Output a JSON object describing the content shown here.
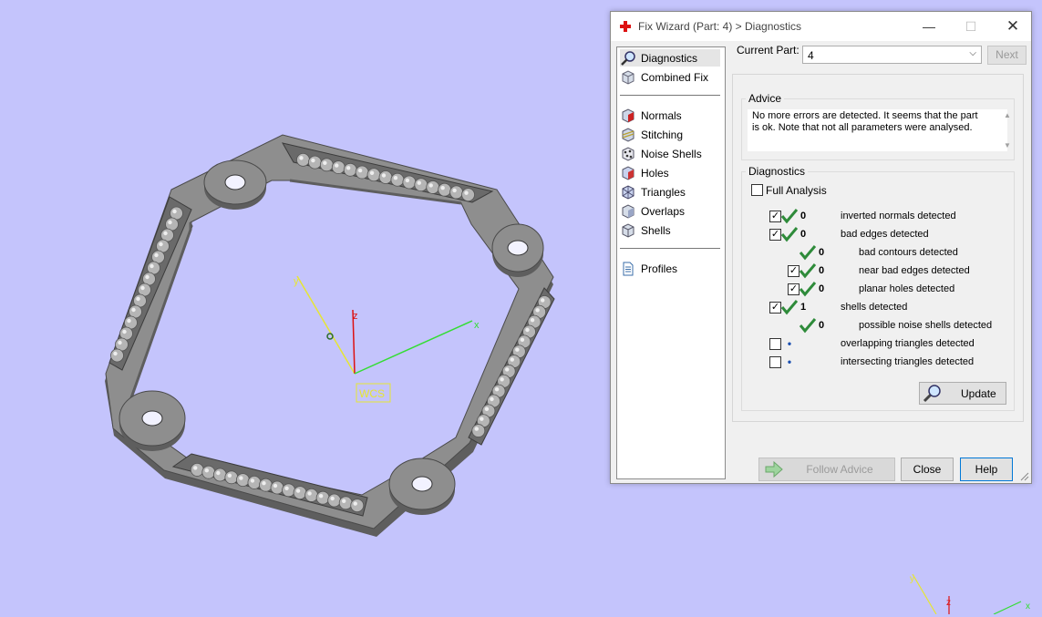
{
  "viewport": {
    "wcs_label": "WCS",
    "axis_x": "x",
    "axis_y": "y",
    "axis_z": "z",
    "colors": {
      "background": "#c4c4fc",
      "part": "#8e8e8e",
      "x_axis": "#33dd33",
      "y_axis": "#e6e633",
      "z_axis": "#dd1111"
    }
  },
  "window": {
    "title": "Fix Wizard (Part: 4) > Diagnostics",
    "controls": {
      "minimize": "—",
      "maximize": "☐",
      "close": "✕"
    }
  },
  "nav": {
    "top_items": [
      {
        "label": "Diagnostics",
        "icon": "magnifier-icon",
        "active": true
      },
      {
        "label": "Combined Fix",
        "icon": "cube-icon"
      }
    ],
    "fix_items": [
      {
        "label": "Normals",
        "icon": "normals-icon"
      },
      {
        "label": "Stitching",
        "icon": "stitching-icon"
      },
      {
        "label": "Noise Shells",
        "icon": "noise-shells-icon"
      },
      {
        "label": "Holes",
        "icon": "holes-icon"
      },
      {
        "label": "Triangles",
        "icon": "triangles-icon"
      },
      {
        "label": "Overlaps",
        "icon": "overlaps-icon"
      },
      {
        "label": "Shells",
        "icon": "shells-icon"
      }
    ],
    "bottom_items": [
      {
        "label": "Profiles",
        "icon": "document-icon"
      }
    ]
  },
  "part": {
    "label": "Current Part:",
    "value": "4",
    "next_label": "Next"
  },
  "advice": {
    "title": "Advice",
    "text": "No more errors are detected. It seems that the part is ok. Note that not all parameters were analysed."
  },
  "diagnostics": {
    "title": "Diagnostics",
    "full_analysis_label": "Full Analysis",
    "full_analysis_checked": false,
    "rows": [
      {
        "checkbox": true,
        "status": "ok",
        "count": "0",
        "label": "inverted normals detected",
        "indent": 0
      },
      {
        "checkbox": true,
        "status": "ok",
        "count": "0",
        "label": "bad edges detected",
        "indent": 0
      },
      {
        "checkbox": null,
        "status": "ok",
        "count": "0",
        "label": "bad contours detected",
        "indent": 1
      },
      {
        "checkbox": true,
        "status": "ok",
        "count": "0",
        "label": "near bad edges detected",
        "indent": 1
      },
      {
        "checkbox": true,
        "status": "ok",
        "count": "0",
        "label": "planar holes detected",
        "indent": 1
      },
      {
        "checkbox": true,
        "status": "ok",
        "count": "1",
        "label": "shells detected",
        "indent": 0
      },
      {
        "checkbox": null,
        "status": "ok",
        "count": "0",
        "label": "possible noise shells detected",
        "indent": 1
      },
      {
        "checkbox": false,
        "status": "dot",
        "count": "",
        "label": "overlapping triangles detected",
        "indent": 0
      },
      {
        "checkbox": false,
        "status": "dot",
        "count": "",
        "label": "intersecting triangles detected",
        "indent": 0
      }
    ],
    "update_label": "Update"
  },
  "buttons": {
    "follow_advice": "Follow Advice",
    "close": "Close",
    "help": "Help"
  }
}
